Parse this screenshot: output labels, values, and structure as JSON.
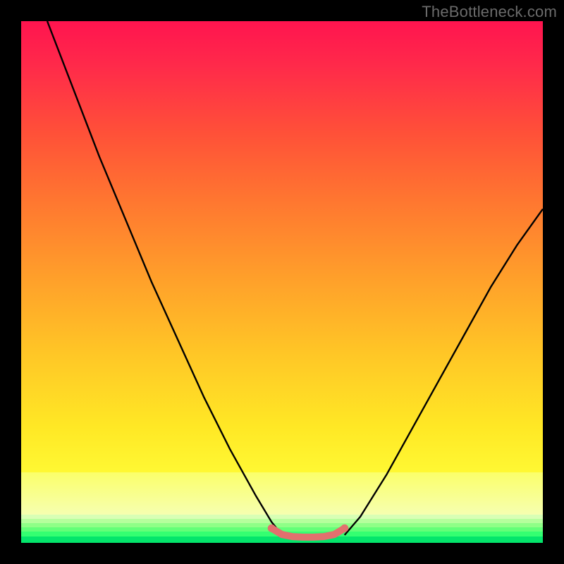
{
  "watermark": "TheBottleneck.com",
  "colors": {
    "frame": "#000000",
    "grad_top": "#ff144f",
    "grad_mid": "#ffa22a",
    "grad_low": "#fff833",
    "pale_yellow": "#f6ffb0",
    "green_bottom": "#04e56b",
    "curve": "#000000",
    "flat_seg": "#e2706e"
  },
  "chart_data": {
    "type": "line",
    "title": "",
    "xlabel": "",
    "ylabel": "",
    "xlim": [
      0,
      100
    ],
    "ylim": [
      0,
      100
    ],
    "series": [
      {
        "name": "curve-left",
        "x": [
          5,
          10,
          15,
          20,
          25,
          30,
          35,
          40,
          45,
          48,
          50
        ],
        "y": [
          100,
          87,
          74,
          62,
          50,
          39,
          28,
          18,
          9,
          4,
          1.5
        ]
      },
      {
        "name": "curve-right",
        "x": [
          62,
          65,
          70,
          75,
          80,
          85,
          90,
          95,
          100
        ],
        "y": [
          1.5,
          5,
          13,
          22,
          31,
          40,
          49,
          57,
          64
        ]
      },
      {
        "name": "flat-segment",
        "x": [
          48,
          50,
          52,
          54,
          56,
          58,
          60,
          62
        ],
        "y": [
          2.8,
          1.6,
          1.2,
          1.1,
          1.1,
          1.2,
          1.6,
          2.8
        ]
      }
    ],
    "annotations": []
  }
}
